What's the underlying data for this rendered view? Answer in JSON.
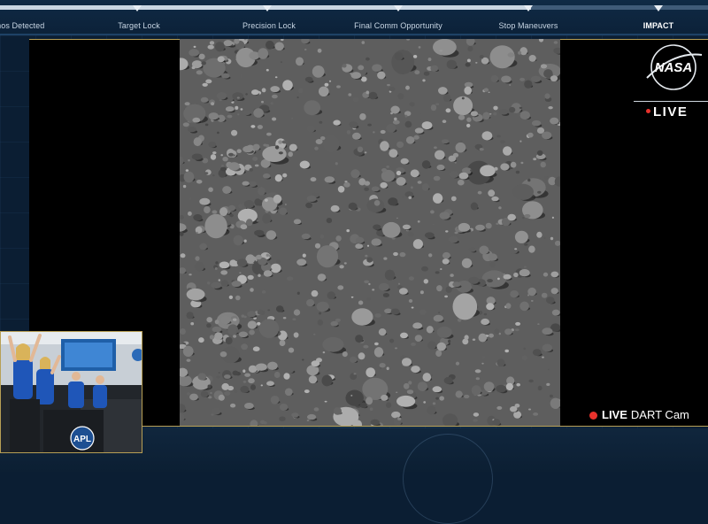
{
  "timeline": {
    "progress_fraction": 0.75,
    "milestones": [
      {
        "label": "mos Detected",
        "active": false
      },
      {
        "label": "Target Lock",
        "active": false
      },
      {
        "label": "Precision Lock",
        "active": false
      },
      {
        "label": "Final Comm Opportunity",
        "active": false
      },
      {
        "label": "Stop Maneuvers",
        "active": false
      },
      {
        "label": "IMPACT",
        "active": true
      }
    ]
  },
  "branding": {
    "logo_text": "NASA",
    "live_badge": "LIVE"
  },
  "feed": {
    "live_word": "LIVE",
    "camera_name": "DART Cam"
  },
  "pip": {
    "monitor_label": "APL"
  },
  "colors": {
    "background": "#0b1e33",
    "accent_gold": "#b79f55",
    "live_red": "#e8322c",
    "nasa_blue": "#0b3d91"
  }
}
